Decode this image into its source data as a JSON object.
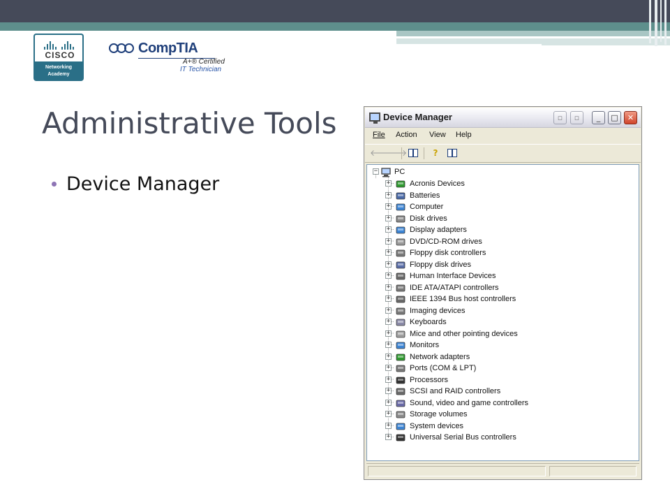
{
  "logos": {
    "cisco_word": "CISCO",
    "cisco_sub_line1": "Networking",
    "cisco_sub_line2": "Academy",
    "comptia_word": "CompTIA",
    "comptia_cert": "A+® Certified",
    "comptia_tech": "IT Technician"
  },
  "slide": {
    "title": "Administrative Tools",
    "bullets": [
      "Device Manager"
    ]
  },
  "window": {
    "title": "Device Manager",
    "menu": [
      "File",
      "Action",
      "View",
      "Help"
    ],
    "root": "PC",
    "devices": [
      {
        "label": "Acronis Devices",
        "icon": "board-icon",
        "color": "#2f9a2f"
      },
      {
        "label": "Batteries",
        "icon": "battery-icon",
        "color": "#4a6aa8"
      },
      {
        "label": "Computer",
        "icon": "computer-icon",
        "color": "#3d86d6"
      },
      {
        "label": "Disk drives",
        "icon": "disk-drive-icon",
        "color": "#8a8a8a"
      },
      {
        "label": "Display adapters",
        "icon": "display-icon",
        "color": "#3d86d6"
      },
      {
        "label": "DVD/CD-ROM drives",
        "icon": "cdrom-icon",
        "color": "#9a9a9a"
      },
      {
        "label": "Floppy disk controllers",
        "icon": "controller-icon",
        "color": "#7a7a7a"
      },
      {
        "label": "Floppy disk drives",
        "icon": "floppy-icon",
        "color": "#5a6ea8"
      },
      {
        "label": "Human Interface Devices",
        "icon": "hid-icon",
        "color": "#6a6a6a"
      },
      {
        "label": "IDE ATA/ATAPI controllers",
        "icon": "ide-icon",
        "color": "#7a7a7a"
      },
      {
        "label": "IEEE 1394 Bus host controllers",
        "icon": "firewire-icon",
        "color": "#6a6a6a"
      },
      {
        "label": "Imaging devices",
        "icon": "camera-icon",
        "color": "#7a7a7a"
      },
      {
        "label": "Keyboards",
        "icon": "keyboard-icon",
        "color": "#8a8aa8"
      },
      {
        "label": "Mice and other pointing devices",
        "icon": "mouse-icon",
        "color": "#a0a0a0"
      },
      {
        "label": "Monitors",
        "icon": "monitor-icon",
        "color": "#3d86d6"
      },
      {
        "label": "Network adapters",
        "icon": "network-icon",
        "color": "#2f9a2f"
      },
      {
        "label": "Ports (COM & LPT)",
        "icon": "port-icon",
        "color": "#7a7a7a"
      },
      {
        "label": "Processors",
        "icon": "processor-icon",
        "color": "#333333"
      },
      {
        "label": "SCSI and RAID controllers",
        "icon": "scsi-icon",
        "color": "#6a6a6a"
      },
      {
        "label": "Sound, video and game controllers",
        "icon": "sound-icon",
        "color": "#6a6aa8"
      },
      {
        "label": "Storage volumes",
        "icon": "storage-icon",
        "color": "#8a8a8a"
      },
      {
        "label": "System devices",
        "icon": "system-icon",
        "color": "#3d86d6"
      },
      {
        "label": "Universal Serial Bus controllers",
        "icon": "usb-icon",
        "color": "#333333"
      }
    ]
  },
  "colors": {
    "banner_dark": "#454a59",
    "banner_teal": "#5e8f8c",
    "title_text": "#454a59",
    "bullet": "#8e75b5"
  }
}
